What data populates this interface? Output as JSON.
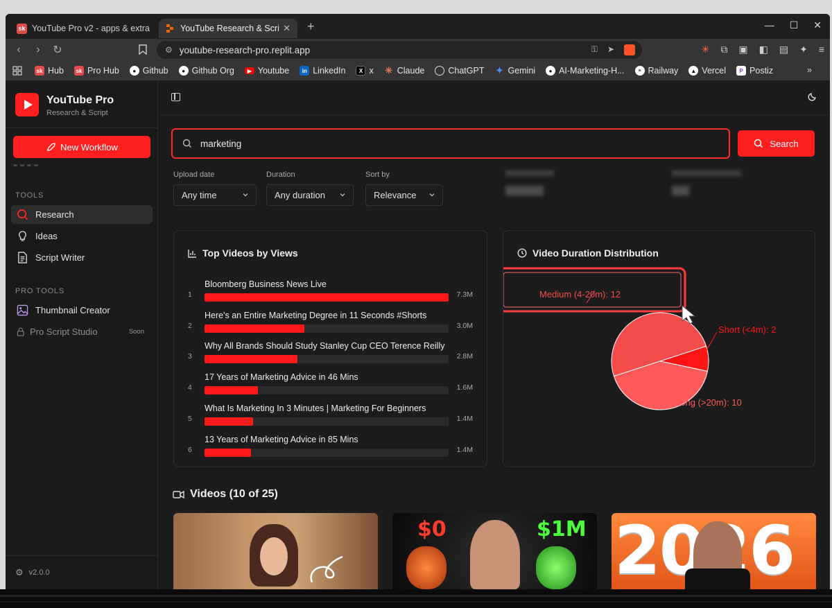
{
  "browser": {
    "tabs": [
      {
        "title": "YouTube Pro v2 - apps & extra",
        "favicon": "sk-favicon"
      },
      {
        "title": "YouTube Research & Script",
        "favicon": "replit-favicon",
        "active": true
      }
    ],
    "url": "youtube-research-pro.replit.app",
    "bookmarks": [
      {
        "label": "Hub",
        "icon": "sk-icon",
        "color": "#e34b4b"
      },
      {
        "label": "Pro Hub",
        "icon": "sk-icon",
        "color": "#e34b4b"
      },
      {
        "label": "Github",
        "icon": "github-icon",
        "color": "#ffffff"
      },
      {
        "label": "Github Org",
        "icon": "github-icon",
        "color": "#ffffff"
      },
      {
        "label": "Youtube",
        "icon": "youtube-icon",
        "color": "#ff0000"
      },
      {
        "label": "LinkedIn",
        "icon": "linkedin-icon",
        "color": "#0a66c2"
      },
      {
        "label": "x",
        "icon": "x-icon",
        "color": "#000000"
      },
      {
        "label": "Claude",
        "icon": "claude-icon",
        "color": "#d97757"
      },
      {
        "label": "ChatGPT",
        "icon": "chatgpt-icon",
        "color": "#ffffff"
      },
      {
        "label": "Gemini",
        "icon": "gemini-icon",
        "color": "#4b8df8"
      },
      {
        "label": "AI-Marketing-H...",
        "icon": "github-icon",
        "color": "#ffffff"
      },
      {
        "label": "Railway",
        "icon": "railway-icon",
        "color": "#ffffff"
      },
      {
        "label": "Vercel",
        "icon": "vercel-icon",
        "color": "#ffffff"
      },
      {
        "label": "Postiz",
        "icon": "postiz-icon",
        "color": "#7b3fe4"
      }
    ]
  },
  "sidebar": {
    "brand": "YouTube Pro",
    "brand_sub": "Research & Script",
    "new_workflow": "New Workflow",
    "tools_heading": "TOOLS",
    "tools": [
      {
        "label": "Research",
        "icon": "search-icon",
        "active": true
      },
      {
        "label": "Ideas",
        "icon": "lightbulb-icon"
      },
      {
        "label": "Script Writer",
        "icon": "document-icon"
      }
    ],
    "pro_heading": "PRO TOOLS",
    "pro_tools": [
      {
        "label": "Thumbnail Creator",
        "icon": "image-icon"
      },
      {
        "label": "Pro Script Studio",
        "icon": "lock-icon",
        "badge": "Soon"
      }
    ],
    "version": "v2.0.0"
  },
  "search": {
    "query": "marketing",
    "button": "Search"
  },
  "filters": [
    {
      "label": "Upload date",
      "value": "Any time"
    },
    {
      "label": "Duration",
      "value": "Any duration"
    },
    {
      "label": "Sort by",
      "value": "Relevance"
    }
  ],
  "top_videos": {
    "title": "Top Videos by Views",
    "items": [
      {
        "rank": "1",
        "title": "Bloomberg Business News Live",
        "views": "7.3M",
        "ratio": 1.0
      },
      {
        "rank": "2",
        "title": "Here's an Entire Marketing Degree in 11 Seconds #Shorts",
        "views": "3.0M",
        "ratio": 0.41
      },
      {
        "rank": "3",
        "title": "Why All Brands Should Study Stanley Cup CEO Terence Reilly",
        "views": "2.8M",
        "ratio": 0.38
      },
      {
        "rank": "4",
        "title": "17 Years of Marketing Advice in 46 Mins",
        "views": "1.6M",
        "ratio": 0.22
      },
      {
        "rank": "5",
        "title": "What Is Marketing In 3 Minutes | Marketing For Beginners",
        "views": "1.4M",
        "ratio": 0.2
      },
      {
        "rank": "6",
        "title": "13 Years of Marketing Advice in 85 Mins",
        "views": "1.4M",
        "ratio": 0.19
      }
    ]
  },
  "duration": {
    "title": "Video Duration Distribution",
    "chart_data": {
      "type": "pie",
      "slices": [
        {
          "label": "Medium (4-20m): 12",
          "value": 12,
          "color": "#f44b4b"
        },
        {
          "label": "Short (<4m): 2",
          "value": 2,
          "color": "#ff1515"
        },
        {
          "label": "Long (>20m): 10",
          "value": 10,
          "color": "#ff5a5a"
        }
      ]
    }
  },
  "videos": {
    "heading": "Videos (10 of 25)",
    "thumb_texts": [
      "$0",
      "$1M",
      "2026"
    ]
  },
  "colors": {
    "accent": "#ff1f1f",
    "bg": "#1c1c1c"
  }
}
